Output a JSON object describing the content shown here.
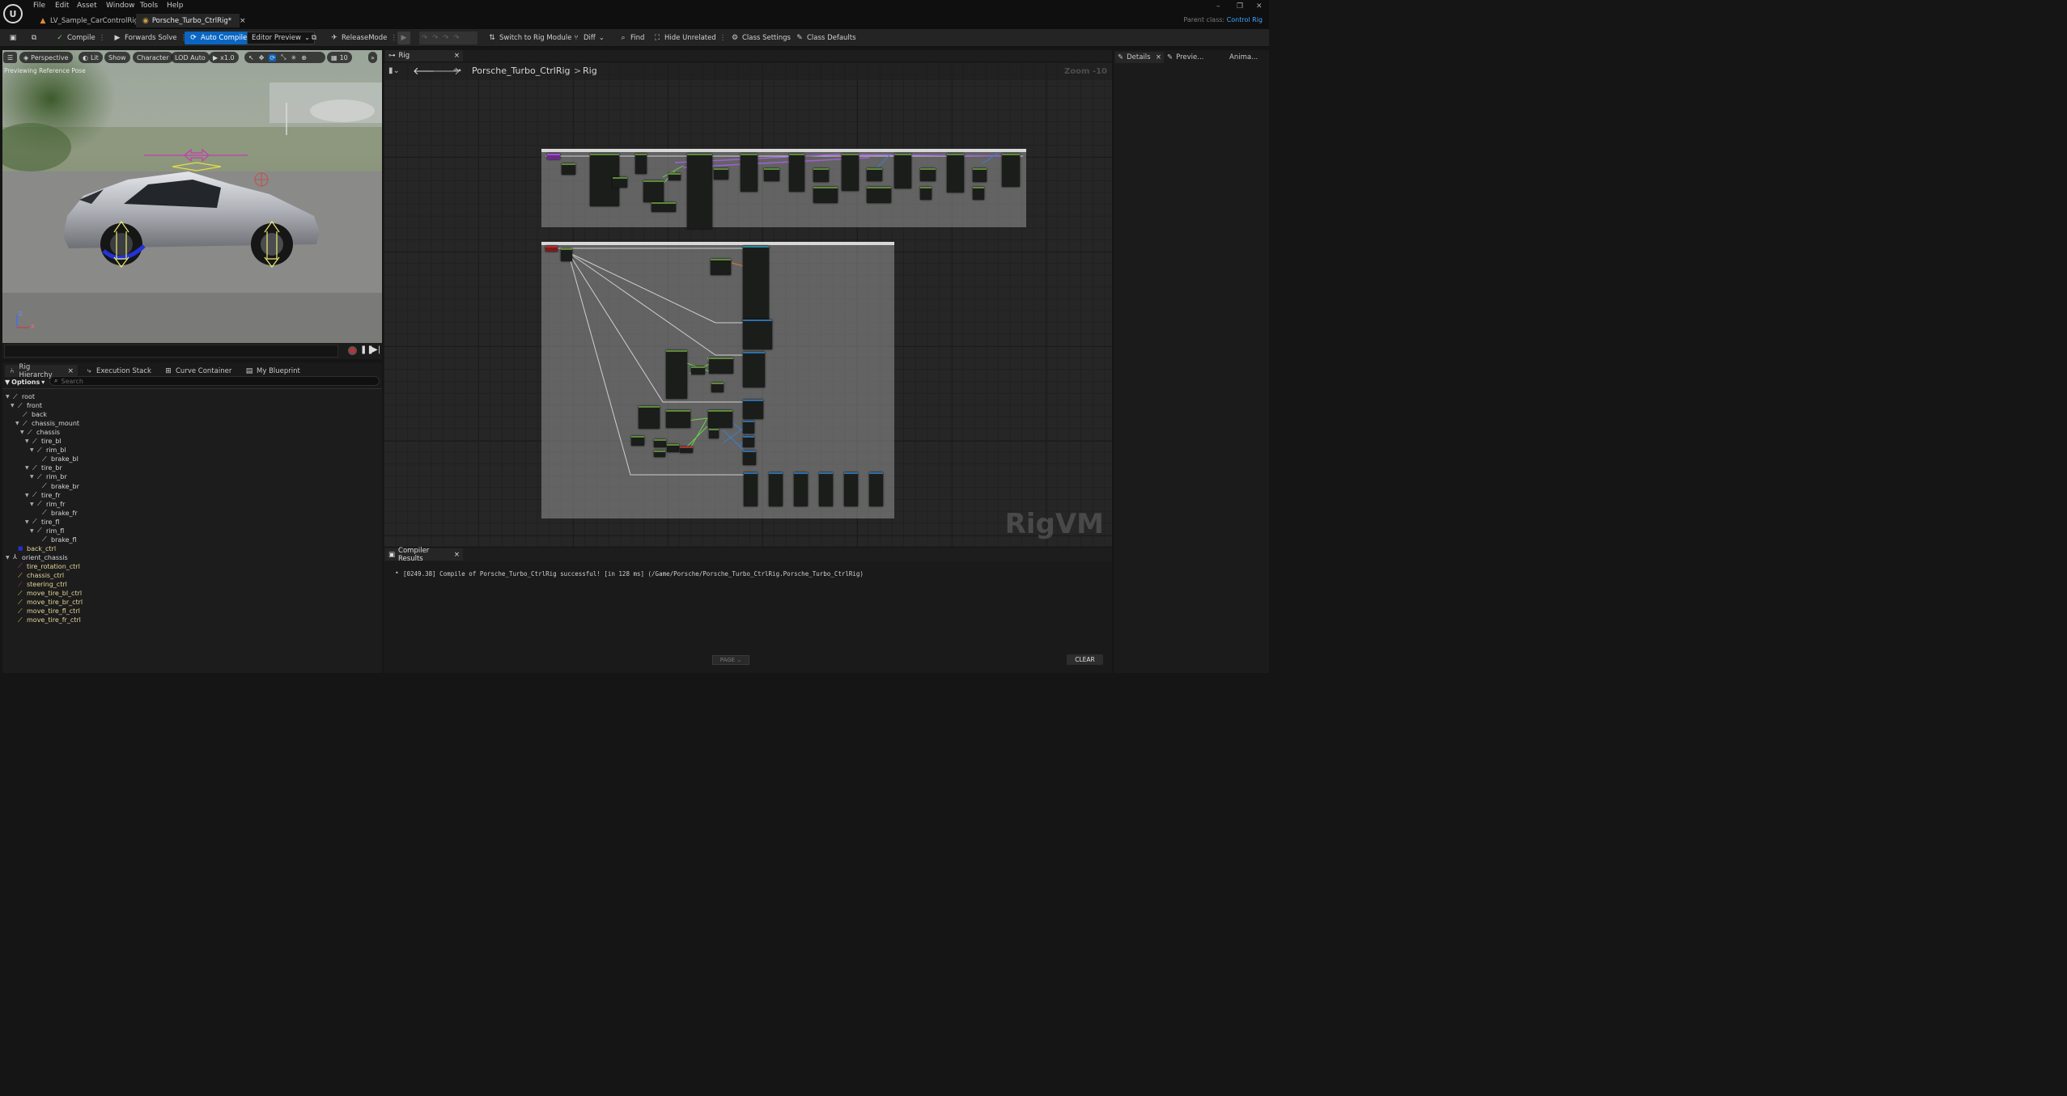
{
  "titlebar": {
    "menus": [
      "File",
      "Edit",
      "Asset",
      "Window",
      "Tools",
      "Help"
    ],
    "tabs": [
      {
        "label": "LV_Sample_CarControlRig"
      },
      {
        "label": "Porsche_Turbo_CtrlRig*"
      }
    ],
    "parent_class_label": "Parent class:",
    "parent_class_value": "Control Rig"
  },
  "toolbar": {
    "compile": "Compile",
    "forwards_solve": "Forwards Solve",
    "auto_compile": "Auto Compile",
    "editor_preview": "Editor Preview",
    "release_mode": "ReleaseMode",
    "switch_rig_module": "Switch to Rig Module",
    "diff": "Diff",
    "find": "Find",
    "hide_unrelated": "Hide Unrelated",
    "class_settings": "Class Settings",
    "class_defaults": "Class Defaults"
  },
  "viewport": {
    "perspective": "Perspective",
    "lit": "Lit",
    "show": "Show",
    "character": "Character",
    "lod": "LOD Auto",
    "speed": "x1.0",
    "grid_value": "10",
    "status": "Previewing Reference Pose",
    "axis_z": "Z",
    "axis_x": "X"
  },
  "left_panel": {
    "tabs": [
      "Rig Hierarchy",
      "Execution Stack",
      "Curve Container",
      "My Blueprint"
    ],
    "options": "Options",
    "search_placeholder": "Search",
    "hierarchy": [
      {
        "label": "root",
        "type": "bone",
        "depth": 0
      },
      {
        "label": "front",
        "type": "bone",
        "depth": 1
      },
      {
        "label": "back",
        "type": "bone",
        "depth": 2
      },
      {
        "label": "chassis_mount",
        "type": "bone",
        "depth": 2
      },
      {
        "label": "chassis",
        "type": "bone",
        "depth": 3
      },
      {
        "label": "tire_bl",
        "type": "bone",
        "depth": 4
      },
      {
        "label": "rim_bl",
        "type": "bone",
        "depth": 5
      },
      {
        "label": "brake_bl",
        "type": "bone",
        "depth": 6
      },
      {
        "label": "tire_br",
        "type": "bone",
        "depth": 4
      },
      {
        "label": "rim_br",
        "type": "bone",
        "depth": 5
      },
      {
        "label": "brake_br",
        "type": "bone",
        "depth": 6
      },
      {
        "label": "tire_fr",
        "type": "bone",
        "depth": 4
      },
      {
        "label": "rim_fr",
        "type": "bone",
        "depth": 5
      },
      {
        "label": "brake_fr",
        "type": "bone",
        "depth": 6
      },
      {
        "label": "tire_fl",
        "type": "bone",
        "depth": 4
      },
      {
        "label": "rim_fl",
        "type": "bone",
        "depth": 5
      },
      {
        "label": "brake_fl",
        "type": "bone",
        "depth": 6
      },
      {
        "label": "back_ctrl",
        "type": "control",
        "depth": 1
      },
      {
        "label": "orient_chassis",
        "type": "null",
        "depth": 0
      },
      {
        "label": "tire_rotation_ctrl",
        "type": "control",
        "depth": 1
      },
      {
        "label": "chassis_ctrl",
        "type": "control",
        "depth": 1
      },
      {
        "label": "steering_ctrl",
        "type": "control",
        "depth": 1
      },
      {
        "label": "move_tire_bl_ctrl",
        "type": "control",
        "depth": 1
      },
      {
        "label": "move_tire_br_ctrl",
        "type": "control",
        "depth": 1
      },
      {
        "label": "move_tire_fl_ctrl",
        "type": "control",
        "depth": 1
      },
      {
        "label": "move_tire_fr_ctrl",
        "type": "control",
        "depth": 1
      }
    ]
  },
  "graph": {
    "tab": "Rig",
    "breadcrumb_asset": "Porsche_Turbo_CtrlRig",
    "breadcrumb_sep": ">",
    "breadcrumb_graph": "Rig",
    "zoom": "Zoom -10",
    "watermark": "RigVM"
  },
  "compiler": {
    "tab": "Compiler Results",
    "message": "[0249.38] Compile of Porsche_Turbo_CtrlRig successful! [in 128 ms] (/Game/Porsche/Porsche_Turbo_CtrlRig.Porsche_Turbo_CtrlRig)",
    "page": "PAGE",
    "clear": "CLEAR"
  },
  "right_panel": {
    "tabs": [
      "Details",
      "Previe...",
      "Anima..."
    ]
  },
  "colors": {
    "accent": "#0a66c2",
    "link": "#3fa7ff",
    "control_text": "#e3d69a"
  }
}
